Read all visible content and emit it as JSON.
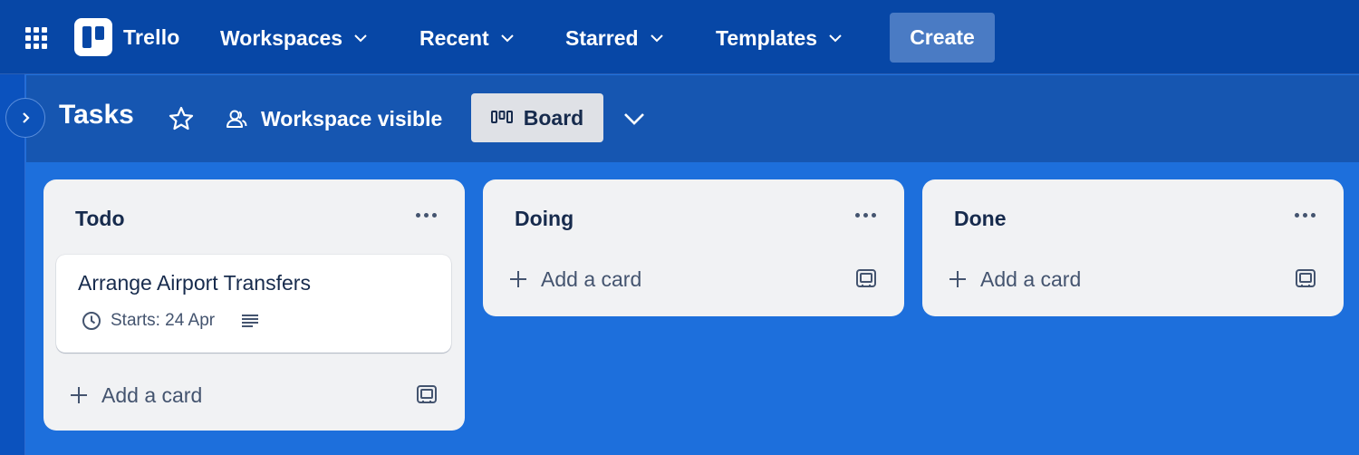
{
  "app": {
    "name": "Trello"
  },
  "nav": {
    "items": [
      {
        "label": "Workspaces"
      },
      {
        "label": "Recent"
      },
      {
        "label": "Starred"
      },
      {
        "label": "Templates"
      }
    ],
    "create_label": "Create"
  },
  "board": {
    "title": "Tasks",
    "visibility": "Workspace visible",
    "view_label": "Board"
  },
  "lists": [
    {
      "title": "Todo",
      "add_card_label": "Add a card",
      "cards": [
        {
          "title": "Arrange Airport Transfers",
          "start_badge": "Starts: 24 Apr",
          "has_description": true
        }
      ]
    },
    {
      "title": "Doing",
      "add_card_label": "Add a card",
      "cards": []
    },
    {
      "title": "Done",
      "add_card_label": "Add a card",
      "cards": []
    }
  ],
  "icons": {
    "apps": "grid-icon",
    "star": "star-icon",
    "visibility": "people-icon",
    "board_view": "board-columns-icon",
    "list_menu": "more-icon",
    "add": "plus-icon",
    "template": "card-template-icon",
    "clock": "clock-icon",
    "description": "description-icon"
  },
  "colors": {
    "nav_bg": "#0747a6",
    "board_bg": "#1d6fdc",
    "list_bg": "#f1f2f4",
    "create_btn": "#4a7bc4"
  }
}
